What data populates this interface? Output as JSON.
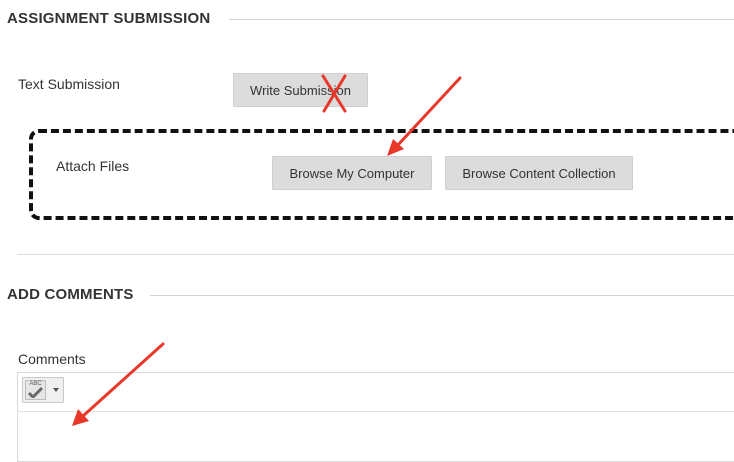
{
  "assignment_submission": {
    "title": "ASSIGNMENT SUBMISSION",
    "text_submission_label": "Text Submission",
    "write_submission_button": "Write Submission",
    "attach_files_label": "Attach Files",
    "browse_computer_button": "Browse My Computer",
    "browse_content_button": "Browse Content Collection"
  },
  "add_comments": {
    "title": "ADD COMMENTS",
    "comments_label": "Comments",
    "spellcheck_icon_text": "ABC"
  },
  "colors": {
    "annotation_red": "#e8382a",
    "dashed_border": "#111111",
    "button_gray": "#dcdcdc"
  }
}
